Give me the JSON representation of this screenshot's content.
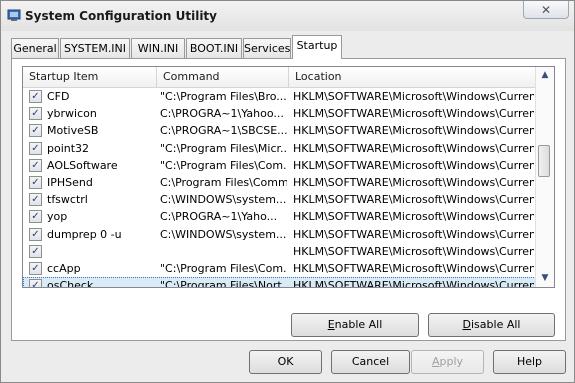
{
  "window": {
    "title": "System Configuration Utility",
    "close_glyph": "✕"
  },
  "tabs": [
    {
      "label": "General"
    },
    {
      "label": "SYSTEM.INI"
    },
    {
      "label": "WIN.INI"
    },
    {
      "label": "BOOT.INI"
    },
    {
      "label": "Services"
    },
    {
      "label": "Startup"
    }
  ],
  "active_tab": "Startup",
  "table": {
    "columns": [
      "Startup Item",
      "Command",
      "Location"
    ],
    "rows": [
      {
        "checked": true,
        "item": "CFD",
        "command": "\"C:\\Program Files\\Bro...",
        "location": "HKLM\\SOFTWARE\\Microsoft\\Windows\\CurrentVer..."
      },
      {
        "checked": true,
        "item": "ybrwicon",
        "command": "C:\\PROGRA~1\\Yahoo...",
        "location": "HKLM\\SOFTWARE\\Microsoft\\Windows\\CurrentVer..."
      },
      {
        "checked": true,
        "item": "MotiveSB",
        "command": "C:\\PROGRA~1\\SBCSE...",
        "location": "HKLM\\SOFTWARE\\Microsoft\\Windows\\CurrentVer..."
      },
      {
        "checked": true,
        "item": "point32",
        "command": "\"C:\\Program Files\\Micr...",
        "location": "HKLM\\SOFTWARE\\Microsoft\\Windows\\CurrentVer..."
      },
      {
        "checked": true,
        "item": "AOLSoftware",
        "command": "\"C:\\Program Files\\Com...",
        "location": "HKLM\\SOFTWARE\\Microsoft\\Windows\\CurrentVer..."
      },
      {
        "checked": true,
        "item": "IPHSend",
        "command": "C:\\Program Files\\Comm...",
        "location": "HKLM\\SOFTWARE\\Microsoft\\Windows\\CurrentVer..."
      },
      {
        "checked": true,
        "item": "tfswctrl",
        "command": "C:\\WINDOWS\\system...",
        "location": "HKLM\\SOFTWARE\\Microsoft\\Windows\\CurrentVer..."
      },
      {
        "checked": true,
        "item": "yop",
        "command": "C:\\PROGRA~1\\Yaho...",
        "location": "HKLM\\SOFTWARE\\Microsoft\\Windows\\CurrentVer..."
      },
      {
        "checked": true,
        "item": "dumprep 0 -u",
        "command": "C:\\WINDOWS\\system...",
        "location": "HKLM\\SOFTWARE\\Microsoft\\Windows\\CurrentVer..."
      },
      {
        "checked": true,
        "item": "",
        "command": "",
        "location": "HKLM\\SOFTWARE\\Microsoft\\Windows\\CurrentVer..."
      },
      {
        "checked": true,
        "item": "ccApp",
        "command": "\"C:\\Program Files\\Com...",
        "location": "HKLM\\SOFTWARE\\Microsoft\\Windows\\CurrentVer..."
      },
      {
        "checked": true,
        "item": "osCheck",
        "command": "\"C:\\Program Files\\Nort...",
        "location": "HKLM\\SOFTWARE\\Microsoft\\Windows\\CurrentVer...",
        "selected": true
      }
    ]
  },
  "check_glyph": "✓",
  "scroll": {
    "up_glyph": "▲",
    "down_glyph": "▼"
  },
  "buttons": {
    "enable_all": {
      "accel": "E",
      "rest": "nable All"
    },
    "disable_all": {
      "accel": "D",
      "rest": "isable All"
    },
    "ok": "OK",
    "cancel": "Cancel",
    "apply": {
      "accel": "A",
      "rest": "pply"
    },
    "help": "Help"
  },
  "colors": {
    "selection": "#d9ebf7",
    "check": "#2a3f7a"
  }
}
